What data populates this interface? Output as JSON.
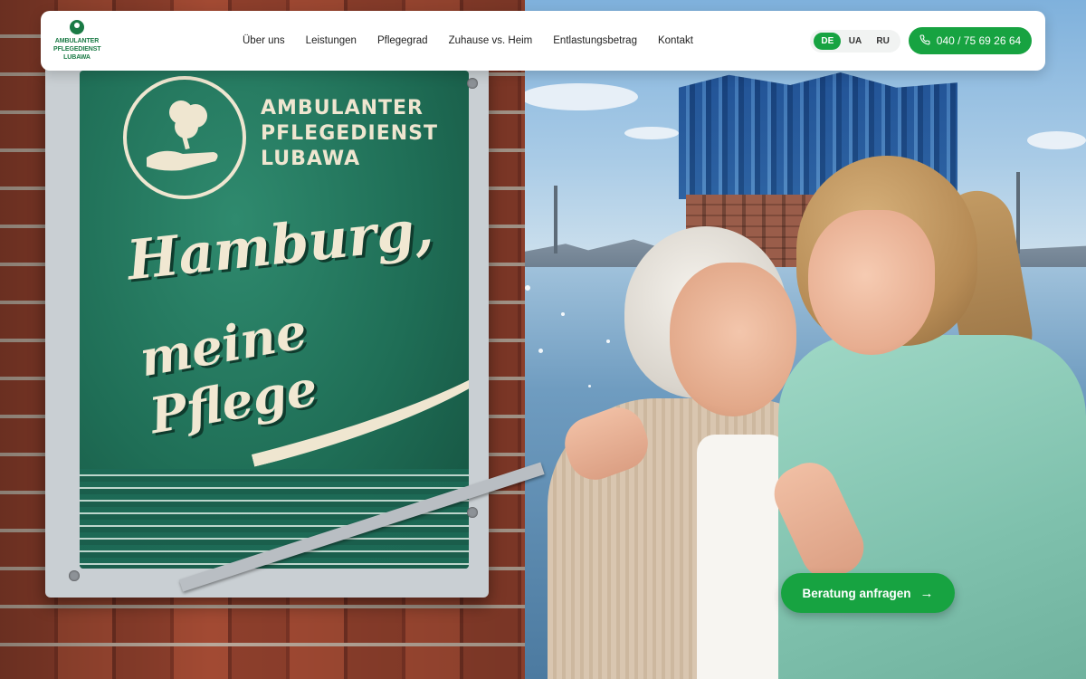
{
  "brand": {
    "logo_lines": [
      "AMBULANTER",
      "PFLEGEDIENST",
      "LUBAWA"
    ]
  },
  "nav": {
    "items": [
      {
        "label": "Über uns"
      },
      {
        "label": "Leistungen"
      },
      {
        "label": "Pflegegrad"
      },
      {
        "label": "Zuhause vs. Heim"
      },
      {
        "label": "Entlastungsbetrag"
      },
      {
        "label": "Kontakt"
      }
    ]
  },
  "languages": {
    "options": [
      "DE",
      "UA",
      "RU"
    ],
    "active": "DE"
  },
  "phone": {
    "number": "040 / 75 69 26 64",
    "icon": "phone-icon"
  },
  "hero": {
    "sign_brand_lines": [
      "AMBULANTER",
      "PFLEGEDIENST",
      "LUBAWA"
    ],
    "sign_headline_1": "Hamburg,",
    "sign_headline_2": "meine Pflege",
    "cta_label": "Beratung anfragen",
    "cta_icon": "arrow-right-icon"
  },
  "colors": {
    "accent": "#17a341",
    "brand_green": "#1a7a45",
    "sign_green": "#1f6e56"
  }
}
